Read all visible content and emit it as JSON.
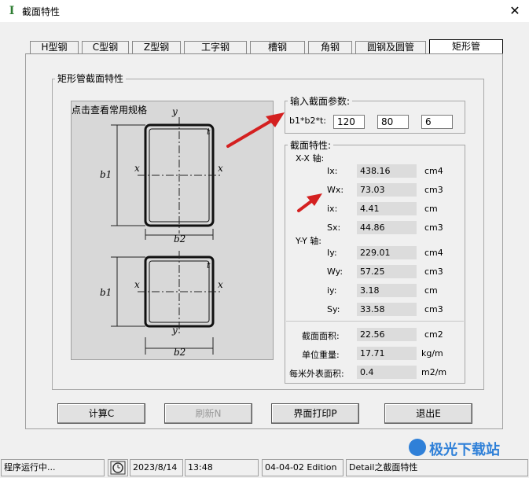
{
  "window": {
    "title": "截面特性",
    "app_icon_glyph": "I",
    "close_glyph": "✕"
  },
  "tabs": [
    {
      "label": "H型钢"
    },
    {
      "label": "C型钢"
    },
    {
      "label": "Z型钢"
    },
    {
      "label": "工字钢"
    },
    {
      "label": "槽钢"
    },
    {
      "label": "角钢"
    },
    {
      "label": "圆钢及圆管"
    },
    {
      "label": "矩形管"
    }
  ],
  "active_tab": "矩形管",
  "main_group_label": "矩形管截面特性",
  "diagram": {
    "header": "点击查看常用规格",
    "top": {
      "y_top": "y",
      "t": "t",
      "x_left": "x",
      "x_right": "x",
      "b1": "b1",
      "b2": "b2"
    },
    "bottom": {
      "t": "t",
      "x_left": "x",
      "x_right": "x",
      "b1": "b1",
      "y_bottom": "y",
      "b2": "b2"
    }
  },
  "input_group": {
    "label": "输入截面参数:",
    "field_label": "b1*b2*t:",
    "b1": "120",
    "b2": "80",
    "t": "6"
  },
  "props_group": {
    "label": "截面特性:",
    "xx_axis_label": "X-X 轴:",
    "yy_axis_label": "Y-Y 轴:",
    "xx_rows": [
      {
        "name": "Ix:",
        "value": "438.16",
        "unit": "cm4"
      },
      {
        "name": "Wx:",
        "value": "73.03",
        "unit": "cm3"
      },
      {
        "name": "ix:",
        "value": "4.41",
        "unit": "cm"
      },
      {
        "name": "Sx:",
        "value": "44.86",
        "unit": "cm3"
      }
    ],
    "yy_rows": [
      {
        "name": "Iy:",
        "value": "229.01",
        "unit": "cm4"
      },
      {
        "name": "Wy:",
        "value": "57.25",
        "unit": "cm3"
      },
      {
        "name": "iy:",
        "value": "3.18",
        "unit": "cm"
      },
      {
        "name": "Sy:",
        "value": "33.58",
        "unit": "cm3"
      }
    ],
    "summary_rows": [
      {
        "name": "截面面积:",
        "value": "22.56",
        "unit": "cm2"
      },
      {
        "name": "单位重量:",
        "value": "17.71",
        "unit": "kg/m"
      },
      {
        "name": "每米外表面积:",
        "value": "0.4",
        "unit": "m2/m"
      }
    ]
  },
  "buttons": {
    "calc": "计算C",
    "refresh": "刷新N",
    "print": "界面打印P",
    "exit": "退出E"
  },
  "statusbar": {
    "status": "程序运行中...",
    "date": "2023/8/14",
    "time": "13:48",
    "version": "04-04-02 Edition",
    "module": "Detail之截面特性"
  },
  "watermark": {
    "text": "极光下载站"
  },
  "colors": {
    "arrow": "#d42020",
    "value_bg": "#dcdcdc",
    "diagram_bg": "#d8d8d8"
  }
}
